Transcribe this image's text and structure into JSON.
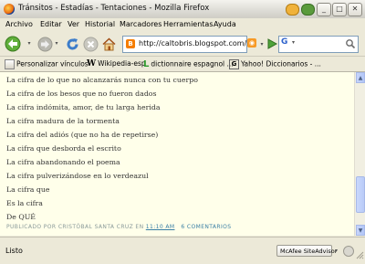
{
  "window": {
    "title": "Tránsitos - Estadías - Tentaciones - Mozilla Firefox",
    "min_label": "_",
    "max_label": "□",
    "close_label": "✕"
  },
  "menu": [
    "Archivo",
    "Editar",
    "Ver",
    "Historial",
    "Marcadores",
    "Herramientas",
    "Ayuda"
  ],
  "navigation": {
    "url": "http://caltobris.blogspot.com/",
    "url_icon_letter": "B",
    "search_engine_letter": "G",
    "feed_icon": "rss-icon"
  },
  "bookmarks": [
    "Personalizar vínculos",
    "Wikipedia-esp",
    "dictionnaire espagnol ...",
    "Yahoo! Diccionarios - ..."
  ],
  "post": {
    "lines": [
      "La cifra de lo que no alcanzarás nunca con tu cuerpo",
      "La cifra de los besos que no fueron dados",
      "La cifra indómita, amor, de tu larga herida",
      "La cifra madura de la tormenta",
      "La cifra del adiós (que no ha de repetirse)",
      "La cifra que desborda el escrito",
      "La cifra abandonando el poema",
      "La cifra pulverizándose en lo verdeazul",
      "La cifra que",
      "Es la cifra",
      "De QUÉ"
    ],
    "footer": {
      "prefix": "PUBLICADO POR ",
      "author": "CRISTÓBAL SANTA CRUZ",
      "at": " EN ",
      "time": "11:10 AM",
      "comments": "6 COMENTARIOS"
    }
  },
  "status": {
    "text": "Listo",
    "mcafee_label": "McAfee SiteAdvisor"
  },
  "colors": {
    "content_bg": "#ffffea",
    "link": "#3a7fa5",
    "footer_text": "#8a9a9a",
    "text": "#333333"
  }
}
